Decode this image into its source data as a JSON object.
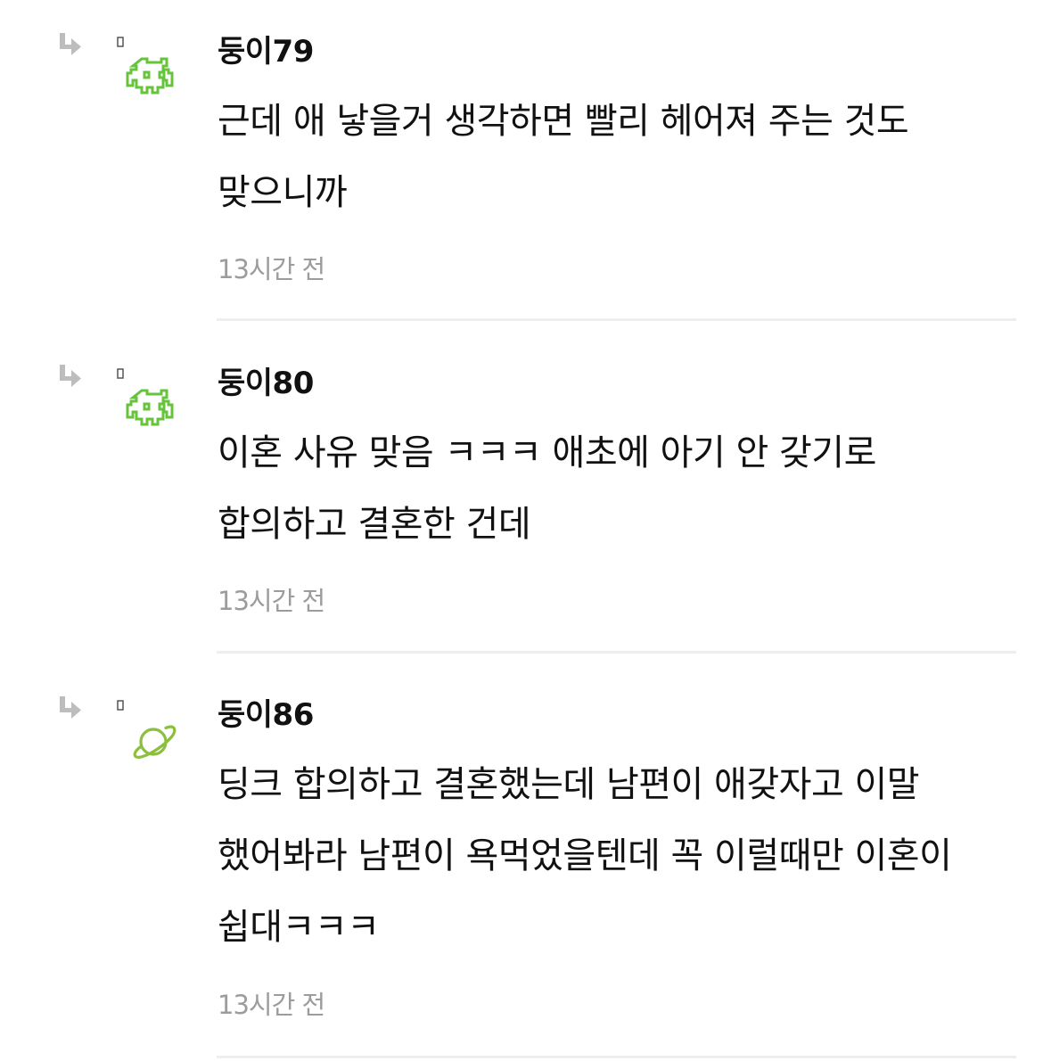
{
  "comments": [
    {
      "author": "둥이79",
      "avatar_icon": "space-invader-icon",
      "avatar_color": "#66c43b",
      "text": "근데 애 낳을거 생각하면 빨리 헤어져 주는 것도 맞으니까",
      "time": "13시간 전"
    },
    {
      "author": "둥이80",
      "avatar_icon": "space-invader-icon",
      "avatar_color": "#66c43b",
      "text": "이혼 사유 맞음 ㅋㅋㅋ 애초에 아기 안 갖기로 합의하고 결혼한 건데",
      "time": "13시간 전"
    },
    {
      "author": "둥이86",
      "avatar_icon": "planet-icon",
      "avatar_color": "#8cbf3f",
      "text": "딩크 합의하고 결혼했는데 남편이 애갖자고 이말 했어봐라 남편이 욕먹었을텐데 꼭 이럴때만 이혼이 쉽대ㅋㅋㅋ",
      "time": "13시간 전"
    }
  ],
  "colors": {
    "reply_arrow": "#bdbdbd",
    "time_text": "#9c9c9c",
    "divider": "#eeeeee"
  }
}
